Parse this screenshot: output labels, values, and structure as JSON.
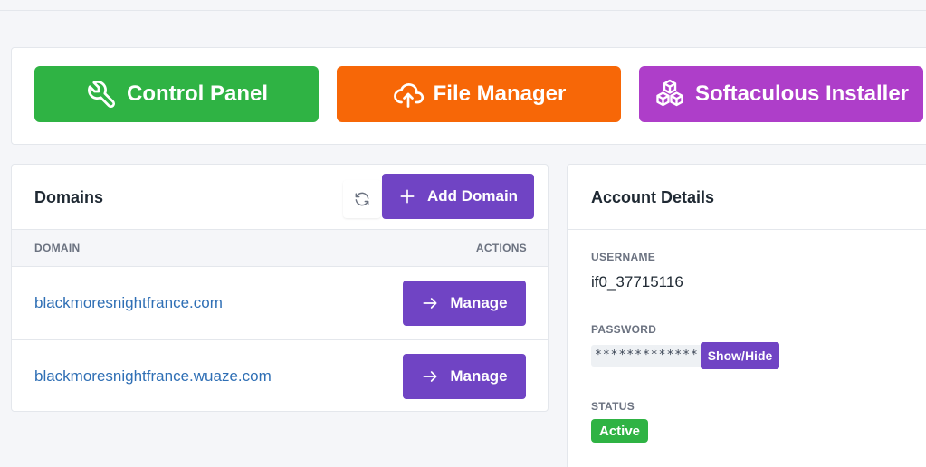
{
  "quick_actions": {
    "control_panel": {
      "label": "Control Panel",
      "icon": "wrench-icon",
      "color": "#2fb344"
    },
    "file_manager": {
      "label": "File Manager",
      "icon": "cloud-upload-icon",
      "color": "#f76707"
    },
    "softaculous": {
      "label": "Softaculous Installer",
      "icon": "cubes-icon",
      "color": "#ae3ec9"
    }
  },
  "domains": {
    "title": "Domains",
    "refresh_icon": "refresh-icon",
    "add_button": "Add Domain",
    "columns": {
      "domain": "DOMAIN",
      "actions": "ACTIONS"
    },
    "rows": [
      {
        "domain": "blackmoresnightfrance.com",
        "action": "Manage"
      },
      {
        "domain": "blackmoresnightfrance.wuaze.com",
        "action": "Manage"
      }
    ]
  },
  "account": {
    "title": "Account Details",
    "username_label": "USERNAME",
    "username": "if0_37715116",
    "password_label": "PASSWORD",
    "password_mask": "*************",
    "show_hide": "Show/Hide",
    "status_label": "STATUS",
    "status": "Active"
  },
  "colors": {
    "accent_purple": "#7044c4",
    "link_blue": "#2f6fb5",
    "status_green": "#2fb344"
  }
}
